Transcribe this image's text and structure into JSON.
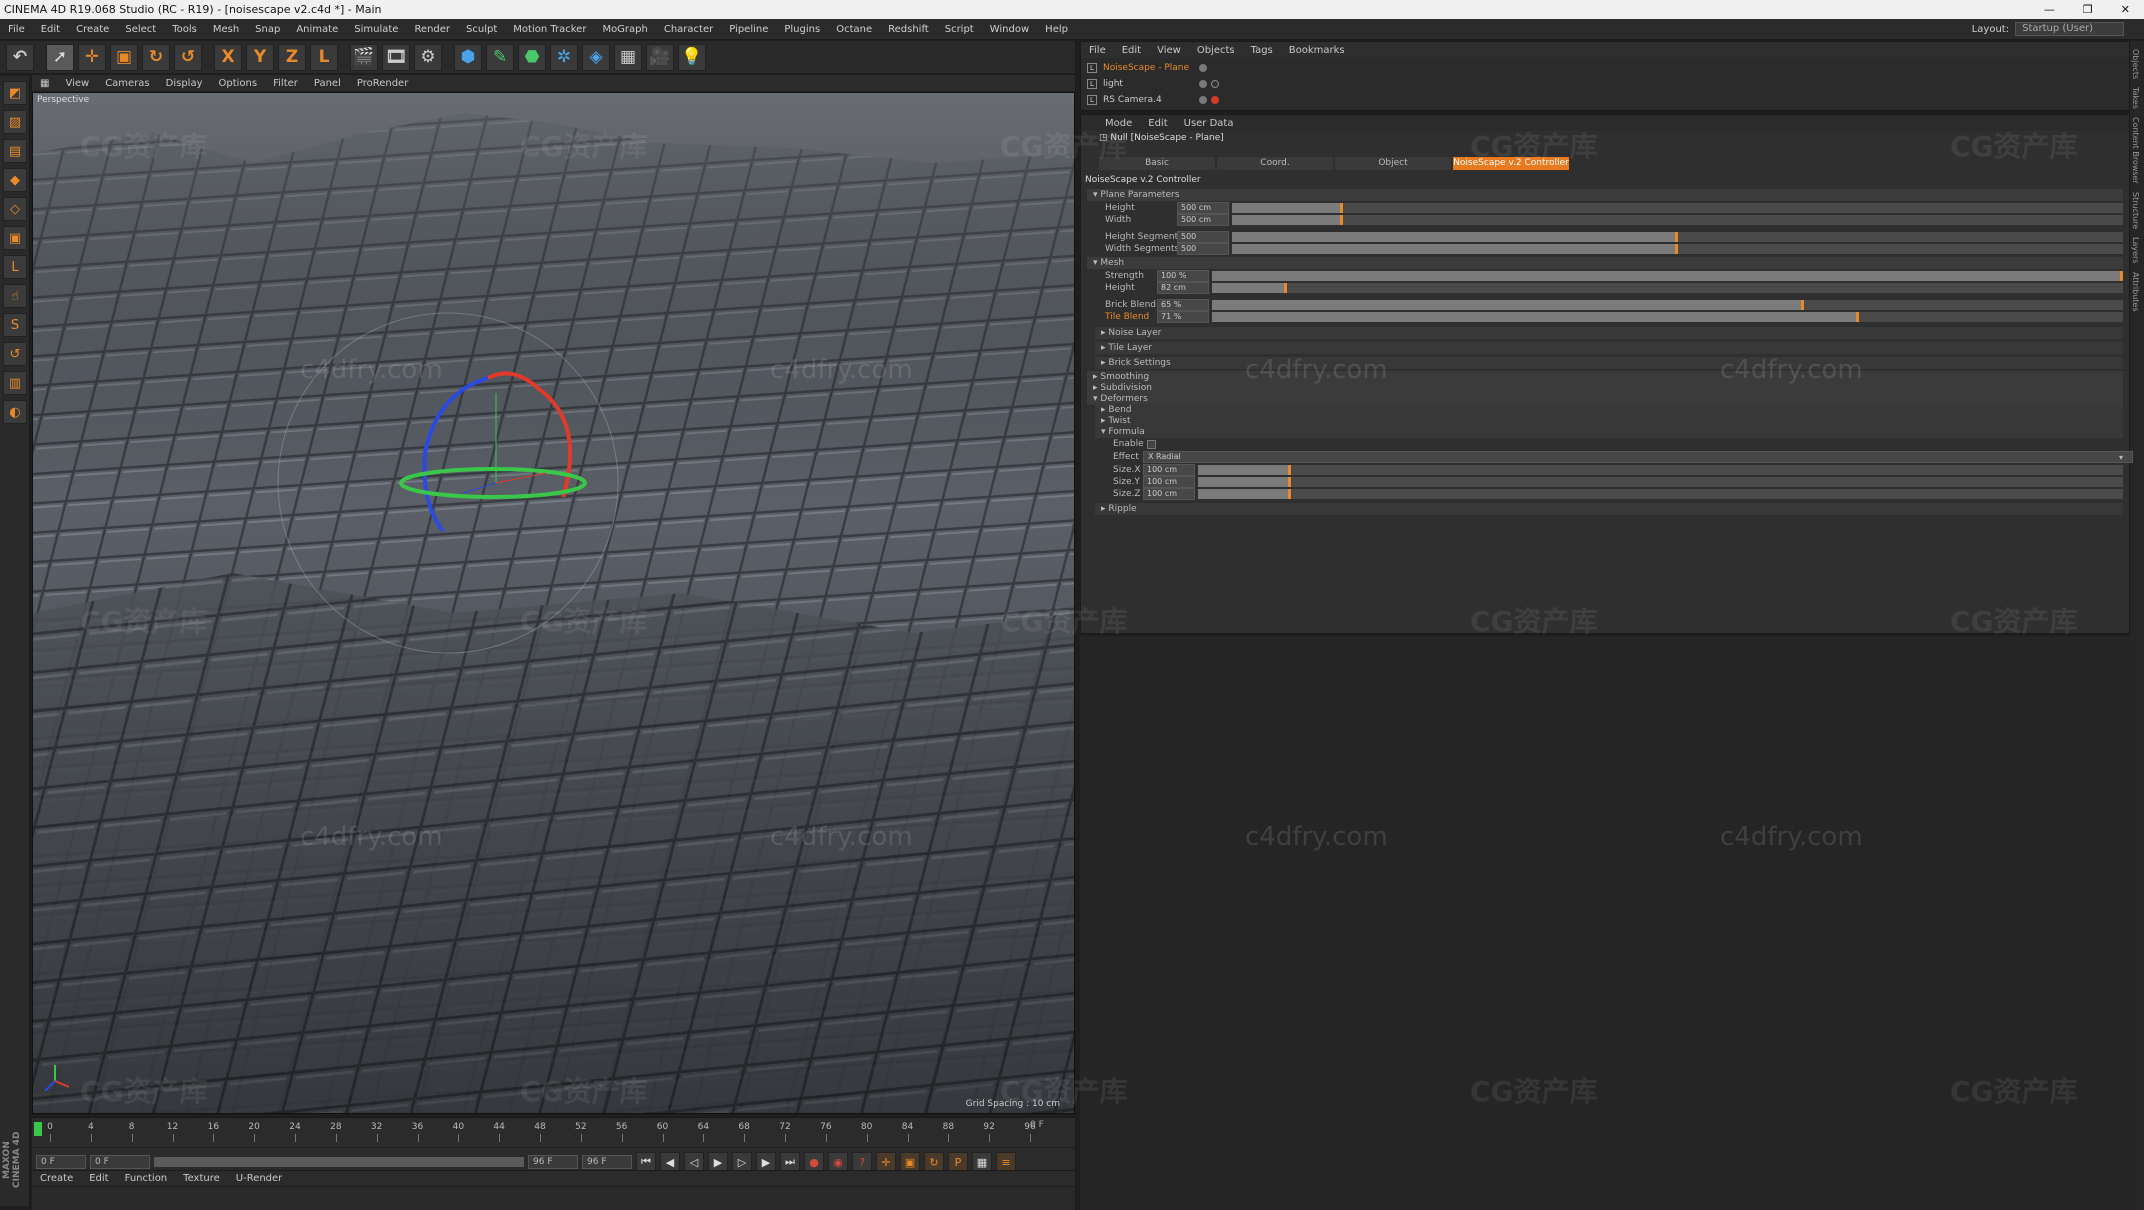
{
  "titlebar": {
    "title": "CINEMA 4D R19.068 Studio (RC - R19) - [noisescape v2.c4d *] - Main"
  },
  "menubar": {
    "items": [
      "File",
      "Edit",
      "Create",
      "Select",
      "Tools",
      "Mesh",
      "Snap",
      "Animate",
      "Simulate",
      "Render",
      "Sculpt",
      "Motion Tracker",
      "MoGraph",
      "Character",
      "Pipeline",
      "Plugins",
      "Octane",
      "Redshift",
      "Script",
      "Window",
      "Help"
    ],
    "layout_label": "Layout:",
    "layout_value": "Startup (User)"
  },
  "toolbar": {
    "icons": [
      "undo-icon",
      "select-arrow-icon",
      "move-icon",
      "scale-icon",
      "rotate-icon",
      "rotate-alt-icon",
      "x-axis-icon",
      "y-axis-icon",
      "z-axis-icon",
      "coord-system-icon",
      "render-view-icon",
      "render-picture-queue-icon",
      "render-settings-icon",
      "cube-icon",
      "pen-icon",
      "subdivision-icon",
      "array-icon",
      "deformer-icon",
      "floor-icon",
      "camera-icon",
      "light-icon"
    ],
    "glyphs": [
      "↶",
      "➚",
      "✛",
      "▣",
      "↻",
      "↺",
      "X",
      "Y",
      "Z",
      "L",
      "🎬",
      "🎞",
      "⚙",
      "⬢",
      "✎",
      "⬣",
      "✲",
      "◈",
      "▦",
      "🎥",
      "💡"
    ]
  },
  "viewport": {
    "menu": [
      "View",
      "Cameras",
      "Display",
      "Options",
      "Filter",
      "Panel",
      "ProRender"
    ],
    "label": "Perspective",
    "grid_spacing": "Grid Spacing : 10 cm"
  },
  "timeline": {
    "ticks": [
      "0",
      "4",
      "8",
      "12",
      "16",
      "20",
      "24",
      "28",
      "32",
      "36",
      "40",
      "44",
      "48",
      "52",
      "56",
      "60",
      "64",
      "68",
      "72",
      "76",
      "80",
      "84",
      "88",
      "92",
      "96"
    ],
    "current_frame": "0 F",
    "start_field": "0 F",
    "min_field": "0 F",
    "max_field": "96 F",
    "end_field": "96 F"
  },
  "material_menu": [
    "Create",
    "Edit",
    "Function",
    "Texture",
    "U-Render"
  ],
  "maxon_label": "MAXON CINEMA 4D",
  "object_manager": {
    "menu": [
      "File",
      "Edit",
      "View",
      "Objects",
      "Tags",
      "Bookmarks"
    ],
    "rows": [
      {
        "name": "NoiseScape - Plane",
        "active": true
      },
      {
        "name": "light",
        "active": false
      },
      {
        "name": "RS Camera.4",
        "active": false
      }
    ]
  },
  "right_strip": [
    "Objects",
    "Takes",
    "Content Browser",
    "Structure",
    "Layers",
    "Attributes"
  ],
  "attributes": {
    "menu": [
      "Mode",
      "Edit",
      "User Data"
    ],
    "header": "Null [NoiseScape - Plane]",
    "tabs": [
      {
        "label": "Basic",
        "active": false
      },
      {
        "label": "Coord.",
        "active": false
      },
      {
        "label": "Object",
        "active": false
      },
      {
        "label": "NoiseScape v.2 Controller",
        "active": true
      }
    ],
    "controller_title": "NoiseScape v.2 Controller",
    "groups": {
      "plane_parameters": "Plane Parameters",
      "mesh": "Mesh",
      "noise_layer": "Noise Layer",
      "tile_layer": "Tile Layer",
      "brick_settings": "Brick Settings",
      "smoothing": "Smoothing",
      "subdivision": "Subdivision",
      "deformers": "Deformers",
      "bend": "Bend",
      "twist": "Twist",
      "formula": "Formula",
      "ripple": "Ripple"
    },
    "plane": [
      {
        "label": "Height",
        "value": "500 cm",
        "fill": 0.125
      },
      {
        "label": "Width",
        "value": "500 cm",
        "fill": 0.125
      },
      {
        "label": "Height Segments",
        "value": "500",
        "fill": 0.5
      },
      {
        "label": "Width Segments",
        "value": "500",
        "fill": 0.5
      }
    ],
    "mesh": [
      {
        "label": "Strength",
        "value": "100 %",
        "fill": 1.0,
        "highlight": false
      },
      {
        "label": "Height",
        "value": "82 cm",
        "fill": 0.082,
        "highlight": false
      },
      {
        "label": "Brick Blend",
        "value": "65 %",
        "fill": 0.65,
        "highlight": false
      },
      {
        "label": "Tile Blend",
        "value": "71 %",
        "fill": 0.71,
        "highlight": true
      }
    ],
    "formula": {
      "enable_label": "Enable",
      "effect_label": "Effect",
      "effect_value": "X Radial",
      "sizes": [
        {
          "label": "Size.X",
          "value": "100 cm",
          "fill": 0.1
        },
        {
          "label": "Size.Y",
          "value": "100 cm",
          "fill": 0.1
        },
        {
          "label": "Size.Z",
          "value": "100 cm",
          "fill": 0.1
        }
      ]
    }
  },
  "watermarks": {
    "cg": "CG资产库",
    "site": "c4dfry.com"
  },
  "colors": {
    "accent": "#e8791f",
    "axis_x": "#e03a2a",
    "axis_y": "#3ac84a",
    "axis_z": "#2a4ae0"
  }
}
